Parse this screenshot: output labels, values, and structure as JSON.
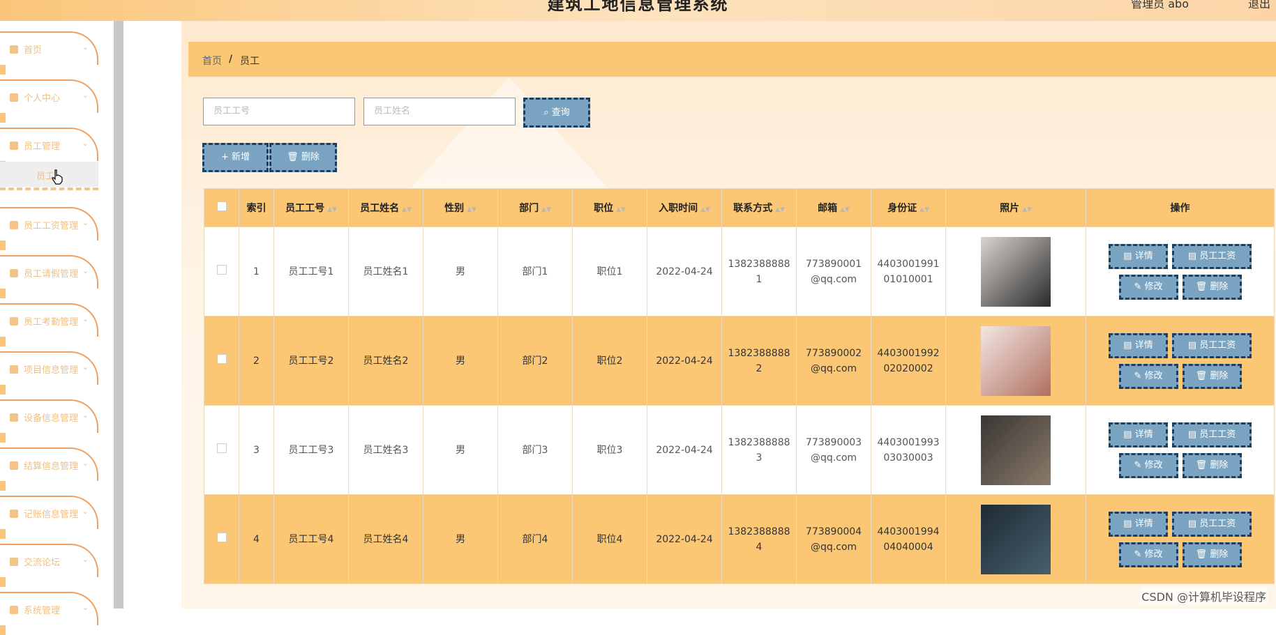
{
  "header": {
    "title": "建筑工地信息管理系统",
    "admin": "管理员 abo",
    "logout": "退出"
  },
  "sidebar": {
    "items": [
      {
        "label": "首页",
        "icon": "home-icon"
      },
      {
        "label": "个人中心",
        "icon": "user-icon"
      },
      {
        "label": "员工管理",
        "icon": "staff-icon"
      },
      {
        "label": "员工工资管理",
        "icon": "grid-icon"
      },
      {
        "label": "员工请假管理",
        "icon": "grid-icon"
      },
      {
        "label": "员工考勤管理",
        "icon": "grid-icon"
      },
      {
        "label": "项目信息管理",
        "icon": "list-icon"
      },
      {
        "label": "设备信息管理",
        "icon": "grid-icon"
      },
      {
        "label": "结算信息管理",
        "icon": "briefcase-icon"
      },
      {
        "label": "记账信息管理",
        "icon": "grid-icon"
      },
      {
        "label": "交流论坛",
        "icon": "send-icon"
      },
      {
        "label": "系统管理",
        "icon": "gear-icon"
      }
    ],
    "sub_item": "员工"
  },
  "breadcrumb": {
    "home": "首页",
    "sep": "/",
    "current": "员工"
  },
  "search": {
    "no_placeholder": "员工工号",
    "name_placeholder": "员工姓名",
    "query_label": "查询"
  },
  "toolbar": {
    "add_label": "新增",
    "delete_label": "删除"
  },
  "table": {
    "columns": [
      "索引",
      "员工工号",
      "员工姓名",
      "性别",
      "部门",
      "职位",
      "入职时间",
      "联系方式",
      "邮箱",
      "身份证",
      "照片",
      "操作"
    ],
    "rows": [
      {
        "index": "1",
        "no": "员工工号1",
        "name": "员工姓名1",
        "gender": "男",
        "dept": "部门1",
        "position": "职位1",
        "date": "2022-04-24",
        "phone1": "1382388888",
        "phone2": "1",
        "email1": "773890001",
        "email2": "@qq.com",
        "id1": "4403001991",
        "id2": "01010001"
      },
      {
        "index": "2",
        "no": "员工工号2",
        "name": "员工姓名2",
        "gender": "男",
        "dept": "部门2",
        "position": "职位2",
        "date": "2022-04-24",
        "phone1": "1382388888",
        "phone2": "2",
        "email1": "773890002",
        "email2": "@qq.com",
        "id1": "4403001992",
        "id2": "02020002"
      },
      {
        "index": "3",
        "no": "员工工号3",
        "name": "员工姓名3",
        "gender": "男",
        "dept": "部门3",
        "position": "职位3",
        "date": "2022-04-24",
        "phone1": "1382388888",
        "phone2": "3",
        "email1": "773890003",
        "email2": "@qq.com",
        "id1": "4403001993",
        "id2": "03030003"
      },
      {
        "index": "4",
        "no": "员工工号4",
        "name": "员工姓名4",
        "gender": "男",
        "dept": "部门4",
        "position": "职位4",
        "date": "2022-04-24",
        "phone1": "1382388888",
        "phone2": "4",
        "email1": "773890004",
        "email2": "@qq.com",
        "id1": "4403001994",
        "id2": "04040004"
      }
    ],
    "actions": {
      "detail": "详情",
      "salary": "员工工资",
      "edit": "修改",
      "delete": "删除"
    }
  },
  "watermark": "CSDN @计算机毕设程序",
  "colors": {
    "accent": "#fbc775",
    "button": "#7aa4c2",
    "button_border": "#1f3e5c",
    "menu_border": "#f0a060"
  }
}
